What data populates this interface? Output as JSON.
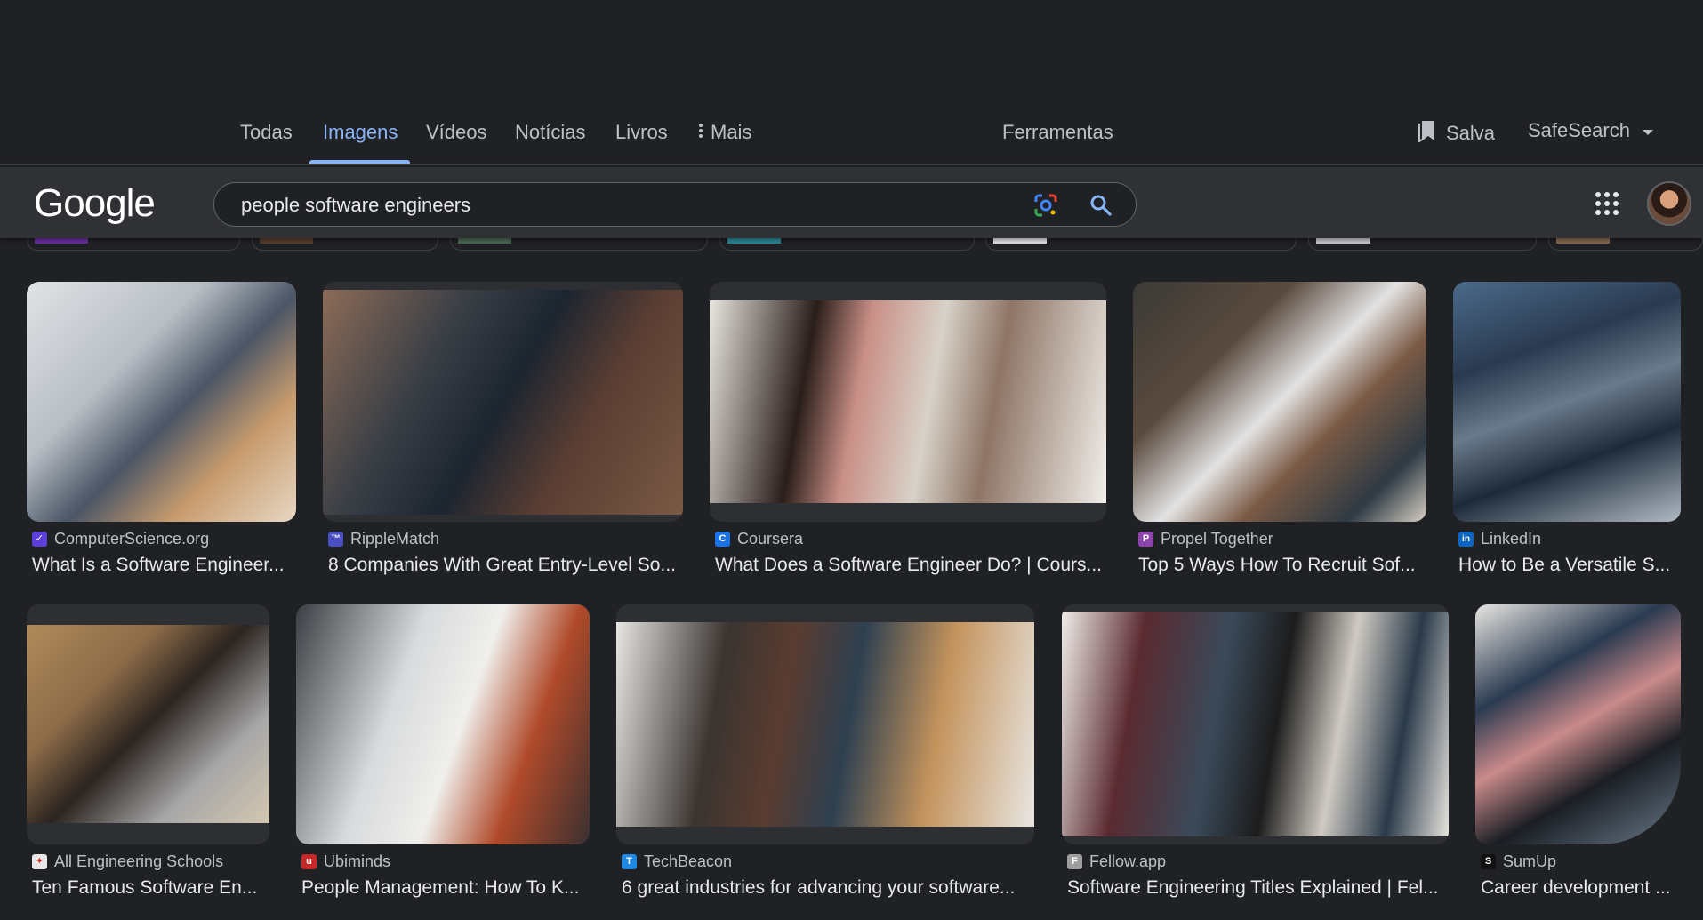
{
  "tabs": {
    "all": "Todas",
    "images": "Imagens",
    "videos": "Vídeos",
    "news": "Notícias",
    "books": "Livros",
    "more": "Mais"
  },
  "tools_label": "Ferramentas",
  "saved_label": "Salva",
  "safesearch_label": "SafeSearch",
  "logo_text": "Google",
  "search": {
    "query": "people software engineers"
  },
  "results": [
    {
      "source": "ComputerScience.org",
      "title": "What Is a Software Engineer...",
      "favicon_color": "#5b3fd6",
      "favicon_char": "✓"
    },
    {
      "source": "RippleMatch",
      "title": "8 Companies With Great Entry-Level So...",
      "favicon_color": "#4a4fc4",
      "favicon_char": "™"
    },
    {
      "source": "Coursera",
      "title": "What Does a Software Engineer Do? | Cours...",
      "favicon_color": "#1a73e8",
      "favicon_char": "C"
    },
    {
      "source": "Propel Together",
      "title": "Top 5 Ways How To Recruit Sof...",
      "favicon_color": "#8e44ad",
      "favicon_char": "P"
    },
    {
      "source": "LinkedIn",
      "title": "How to Be a Versatile S...",
      "favicon_color": "#0a66c2",
      "favicon_char": "in"
    },
    {
      "source": "All Engineering Schools",
      "title": "Ten Famous Software En...",
      "favicon_color": "#e8e8e8",
      "favicon_char": "✦"
    },
    {
      "source": "Ubiminds",
      "title": "People Management: How To K...",
      "favicon_color": "#c62828",
      "favicon_char": "u"
    },
    {
      "source": "TechBeacon",
      "title": "6 great industries for advancing your software...",
      "favicon_color": "#1e88e5",
      "favicon_char": "T"
    },
    {
      "source": "Fellow.app",
      "title": "Software Engineering Titles Explained | Fel...",
      "favicon_color": "#9e9e9e",
      "favicon_char": "F"
    },
    {
      "source": "SumUp",
      "title": "Career development ...",
      "favicon_color": "#111111",
      "favicon_char": "S"
    }
  ]
}
